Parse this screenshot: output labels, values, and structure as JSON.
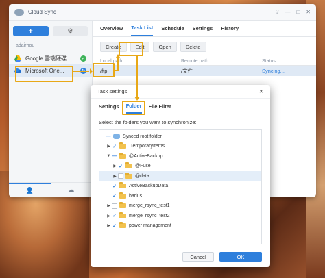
{
  "app": {
    "title": "Cloud Sync",
    "window_controls": [
      "?",
      "—",
      "□",
      "✕"
    ]
  },
  "sidebar": {
    "add_label": "+",
    "user": "adairhou",
    "connections": [
      {
        "label": "Google 雲端硬碟",
        "status": "ok"
      },
      {
        "label": "Microsoft One...",
        "status": "syncing"
      }
    ]
  },
  "tabs": [
    "Overview",
    "Task List",
    "Schedule",
    "Settings",
    "History"
  ],
  "toolbar": {
    "create": "Create",
    "edit": "Edit",
    "open": "Open",
    "delete": "Delete"
  },
  "table": {
    "headers": [
      "Local path",
      "Remote path",
      "Status"
    ],
    "rows": [
      {
        "local": "/ftp",
        "remote": "/文件",
        "status": "Syncing..."
      }
    ]
  },
  "dialog": {
    "title": "Task settings",
    "tabs": [
      "Settings",
      "Folder",
      "File Filter"
    ],
    "description": "Select the folders you want to synchronize:",
    "tree": [
      {
        "label": "Synced root folder",
        "state": "partial"
      },
      {
        "label": ".TemporaryItems",
        "state": "checked"
      },
      {
        "label": "@ActiveBackup",
        "state": "partial"
      },
      {
        "label": "@Fuse",
        "state": "checked"
      },
      {
        "label": "@data",
        "state": "unchecked"
      },
      {
        "label": "ActiveBackupData",
        "state": "checked"
      },
      {
        "label": "barlus",
        "state": "checked"
      },
      {
        "label": "merge_rsync_test1",
        "state": "unchecked"
      },
      {
        "label": "merge_rsync_test2",
        "state": "checked"
      },
      {
        "label": "power management",
        "state": "checked"
      }
    ],
    "cancel": "Cancel",
    "ok": "OK"
  },
  "colors": {
    "accent": "#2e7fdc",
    "highlight": "#e8a817"
  }
}
